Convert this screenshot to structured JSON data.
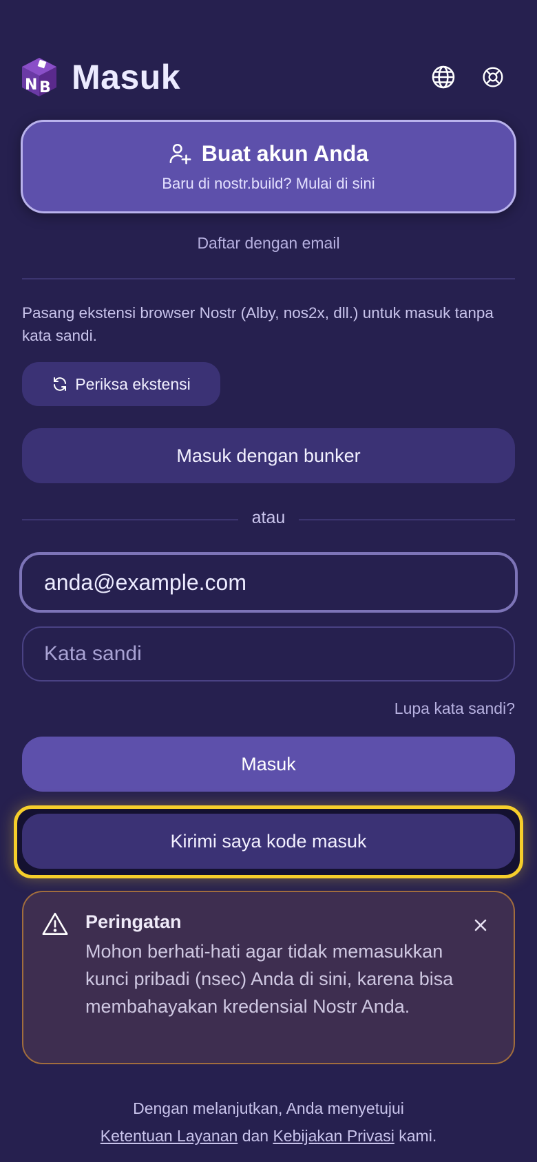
{
  "header": {
    "title": "Masuk",
    "logo_text": "NB"
  },
  "create_account": {
    "title": "Buat akun Anda",
    "subtitle": "Baru di nostr.build? Mulai di sini"
  },
  "email_signup_link": "Daftar dengan email",
  "extension": {
    "description": "Pasang ekstensi browser Nostr (Alby, nos2x, dll.) untuk masuk tanpa kata sandi.",
    "check_button": "Periksa ekstensi"
  },
  "bunker_button": "Masuk dengan bunker",
  "or_text": "atau",
  "email_field": {
    "value": "anda@example.com"
  },
  "password_field": {
    "placeholder": "Kata sandi"
  },
  "forgot_password": "Lupa kata sandi?",
  "login_button": "Masuk",
  "code_button": "Kirimi saya kode masuk",
  "warning": {
    "title": "Peringatan",
    "body": "Mohon berhati-hati agar tidak memasukkan kunci pribadi (nsec) Anda di sini, karena bisa membahayakan kredensial Nostr Anda."
  },
  "footer": {
    "prefix": "Dengan melanjutkan, Anda menyetujui",
    "terms": "Ketentuan Layanan",
    "and": "dan",
    "privacy": "Kebijakan Privasi",
    "suffix": "kami."
  },
  "colors": {
    "background": "#26204f",
    "accent": "#5d50ab",
    "highlight": "#f6ce2b",
    "warning_border": "#a16d3d"
  }
}
